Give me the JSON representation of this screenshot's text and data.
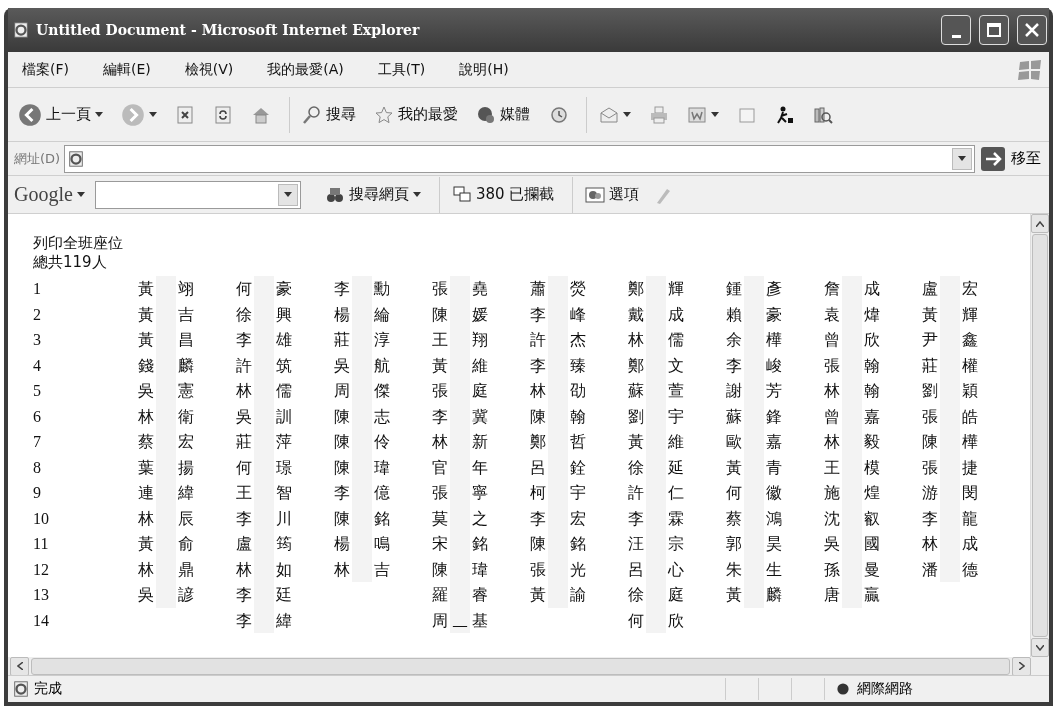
{
  "window": {
    "title": "Untitled Document - Microsoft Internet Explorer"
  },
  "menu": [
    "檔案(F)",
    "編輯(E)",
    "檢視(V)",
    "我的最愛(A)",
    "工具(T)",
    "說明(H)"
  ],
  "toolbar": [
    {
      "kind": "back",
      "label": "上一頁",
      "dropdown": true
    },
    {
      "kind": "forward",
      "dropdown": true
    },
    {
      "kind": "stop"
    },
    {
      "kind": "refresh"
    },
    {
      "kind": "home"
    },
    {
      "kind": "sep"
    },
    {
      "kind": "search",
      "label": "搜尋"
    },
    {
      "kind": "favorites",
      "label": "我的最愛"
    },
    {
      "kind": "media",
      "label": "媒體"
    },
    {
      "kind": "history"
    },
    {
      "kind": "sep"
    },
    {
      "kind": "mail",
      "dropdown": true
    },
    {
      "kind": "print"
    },
    {
      "kind": "word",
      "dropdown": true
    },
    {
      "kind": "note"
    },
    {
      "kind": "messenger"
    },
    {
      "kind": "research"
    }
  ],
  "address": {
    "label": "網址(D)",
    "go": "移至"
  },
  "google_bar": {
    "logo": "Google",
    "search_button": "搜尋網頁",
    "blocked": "380 已攔截",
    "options": "選項"
  },
  "page": {
    "heading": "列印全班座位",
    "total": "總共119人",
    "row_numbers": [
      "1",
      "2",
      "3",
      "4",
      "5",
      "6",
      "7",
      "8",
      "9",
      "10",
      "11",
      "12",
      "13",
      "14"
    ],
    "seat_columns": [
      [
        {
          "surname": "黃",
          "given": "翊"
        },
        {
          "surname": "黃",
          "given": "吉"
        },
        {
          "surname": "黃",
          "given": "昌"
        },
        {
          "surname": "錢",
          "given": "麟"
        },
        {
          "surname": "吳",
          "given": "憲"
        },
        {
          "surname": "林",
          "given": "衛"
        },
        {
          "surname": "蔡",
          "given": "宏"
        },
        {
          "surname": "葉",
          "given": "揚"
        },
        {
          "surname": "連",
          "given": "緯"
        },
        {
          "surname": "林",
          "given": "辰"
        },
        {
          "surname": "黃",
          "given": "俞"
        },
        {
          "surname": "林",
          "given": "鼎"
        },
        {
          "surname": "吳",
          "given": "諺"
        }
      ],
      [
        {
          "surname": "何",
          "given": "豪"
        },
        {
          "surname": "徐",
          "given": "興"
        },
        {
          "surname": "李",
          "given": "雄"
        },
        {
          "surname": "許",
          "given": "筑"
        },
        {
          "surname": "林",
          "given": "儒"
        },
        {
          "surname": "吳",
          "given": "訓"
        },
        {
          "surname": "莊",
          "given": "萍"
        },
        {
          "surname": "何",
          "given": "璟"
        },
        {
          "surname": "王",
          "given": "智"
        },
        {
          "surname": "李",
          "given": "川"
        },
        {
          "surname": "盧",
          "given": "筠"
        },
        {
          "surname": "林",
          "given": "如"
        },
        {
          "surname": "李",
          "given": "廷"
        },
        {
          "surname": "李",
          "given": "緯"
        }
      ],
      [
        {
          "surname": "李",
          "given": "勳"
        },
        {
          "surname": "楊",
          "given": "綸"
        },
        {
          "surname": "莊",
          "given": "淳"
        },
        {
          "surname": "吳",
          "given": "航"
        },
        {
          "surname": "周",
          "given": "傑"
        },
        {
          "surname": "陳",
          "given": "志"
        },
        {
          "surname": "陳",
          "given": "伶"
        },
        {
          "surname": "陳",
          "given": "瑋"
        },
        {
          "surname": "李",
          "given": "億"
        },
        {
          "surname": "陳",
          "given": "銘"
        },
        {
          "surname": "楊",
          "given": "鳴"
        },
        {
          "surname": "林",
          "given": "吉"
        }
      ],
      [
        {
          "surname": "張",
          "given": "堯"
        },
        {
          "surname": "陳",
          "given": "媛"
        },
        {
          "surname": "王",
          "given": "翔"
        },
        {
          "surname": "黃",
          "given": "維"
        },
        {
          "surname": "張",
          "given": "庭"
        },
        {
          "surname": "李",
          "given": "冀"
        },
        {
          "surname": "林",
          "given": "新"
        },
        {
          "surname": "官",
          "given": "年"
        },
        {
          "surname": "張",
          "given": "寧"
        },
        {
          "surname": "莫",
          "given": "之"
        },
        {
          "surname": "宋",
          "given": "銘"
        },
        {
          "surname": "陳",
          "given": "瑋"
        },
        {
          "surname": "羅",
          "given": "睿"
        },
        {
          "surname": "周",
          "middle": "__",
          "given": "基"
        }
      ],
      [
        {
          "surname": "蕭",
          "given": "熒"
        },
        {
          "surname": "李",
          "given": "峰"
        },
        {
          "surname": "許",
          "given": "杰"
        },
        {
          "surname": "李",
          "given": "臻"
        },
        {
          "surname": "林",
          "given": "劭"
        },
        {
          "surname": "陳",
          "given": "翰"
        },
        {
          "surname": "鄭",
          "given": "哲"
        },
        {
          "surname": "呂",
          "given": "銓"
        },
        {
          "surname": "柯",
          "given": "宇"
        },
        {
          "surname": "李",
          "given": "宏"
        },
        {
          "surname": "陳",
          "given": "銘"
        },
        {
          "surname": "張",
          "given": "光"
        },
        {
          "surname": "黃",
          "given": "諭"
        }
      ],
      [
        {
          "surname": "鄭",
          "given": "輝"
        },
        {
          "surname": "戴",
          "given": "成"
        },
        {
          "surname": "林",
          "given": "儒"
        },
        {
          "surname": "鄭",
          "given": "文"
        },
        {
          "surname": "蘇",
          "given": "萱"
        },
        {
          "surname": "劉",
          "given": "宇"
        },
        {
          "surname": "黃",
          "given": "維"
        },
        {
          "surname": "徐",
          "given": "延"
        },
        {
          "surname": "許",
          "given": "仁"
        },
        {
          "surname": "李",
          "given": "霖"
        },
        {
          "surname": "汪",
          "given": "宗"
        },
        {
          "surname": "呂",
          "given": "心"
        },
        {
          "surname": "徐",
          "given": "庭"
        },
        {
          "surname": "何",
          "given": "欣"
        }
      ],
      [
        {
          "surname": "鍾",
          "given": "彥"
        },
        {
          "surname": "賴",
          "given": "豪"
        },
        {
          "surname": "余",
          "given": "樺"
        },
        {
          "surname": "李",
          "given": "峻"
        },
        {
          "surname": "謝",
          "given": "芳"
        },
        {
          "surname": "蘇",
          "given": "鋒"
        },
        {
          "surname": "歐",
          "given": "嘉"
        },
        {
          "surname": "黃",
          "given": "青"
        },
        {
          "surname": "何",
          "given": "徽"
        },
        {
          "surname": "蔡",
          "given": "鴻"
        },
        {
          "surname": "郭",
          "given": "昊"
        },
        {
          "surname": "朱",
          "given": "生"
        },
        {
          "surname": "黃",
          "given": "麟"
        }
      ],
      [
        {
          "surname": "詹",
          "given": "成"
        },
        {
          "surname": "袁",
          "given": "煒"
        },
        {
          "surname": "曾",
          "given": "欣"
        },
        {
          "surname": "張",
          "given": "翰"
        },
        {
          "surname": "林",
          "given": "翰"
        },
        {
          "surname": "曾",
          "given": "嘉"
        },
        {
          "surname": "林",
          "given": "毅"
        },
        {
          "surname": "王",
          "given": "模"
        },
        {
          "surname": "施",
          "given": "煌"
        },
        {
          "surname": "沈",
          "given": "叡"
        },
        {
          "surname": "吳",
          "given": "國"
        },
        {
          "surname": "孫",
          "given": "曼"
        },
        {
          "surname": "唐",
          "given": "贏"
        }
      ],
      [
        {
          "surname": "盧",
          "given": "宏"
        },
        {
          "surname": "黃",
          "given": "輝"
        },
        {
          "surname": "尹",
          "given": "鑫"
        },
        {
          "surname": "莊",
          "given": "權"
        },
        {
          "surname": "劉",
          "given": "穎"
        },
        {
          "surname": "張",
          "given": "皓"
        },
        {
          "surname": "陳",
          "given": "樺"
        },
        {
          "surname": "張",
          "given": "捷"
        },
        {
          "surname": "游",
          "given": "閔"
        },
        {
          "surname": "李",
          "given": "龍"
        },
        {
          "surname": "林",
          "given": "成"
        },
        {
          "surname": "潘",
          "given": "德"
        }
      ]
    ]
  },
  "status_bar": {
    "text": "完成",
    "zone": "網際網路"
  }
}
